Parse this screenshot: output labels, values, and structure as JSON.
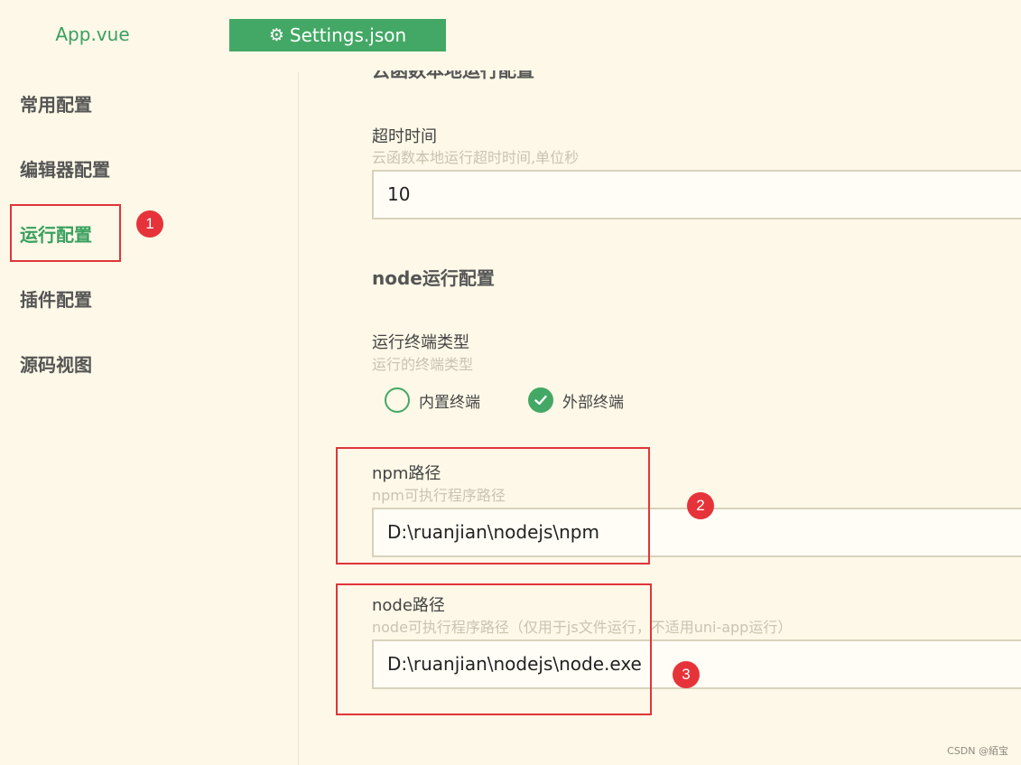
{
  "tabs": [
    {
      "label": "App.vue",
      "active": false
    },
    {
      "label": "Settings.json",
      "active": true,
      "icon": "gear-icon"
    }
  ],
  "sidebar": {
    "items": [
      {
        "label": "常用配置",
        "active": false
      },
      {
        "label": "编辑器配置",
        "active": false
      },
      {
        "label": "运行配置",
        "active": true
      },
      {
        "label": "插件配置",
        "active": false
      },
      {
        "label": "源码视图",
        "active": false
      }
    ]
  },
  "main": {
    "section_cloud_title": "云函数本地运行配置",
    "timeout": {
      "label": "超时时间",
      "description": "云函数本地运行超时时间,单位秒",
      "value": "10"
    },
    "section_node_title": "node运行配置",
    "terminal_type": {
      "label": "运行终端类型",
      "description": "运行的终端类型",
      "options": [
        {
          "label": "内置终端",
          "checked": false
        },
        {
          "label": "外部终端",
          "checked": true
        }
      ]
    },
    "npm_path": {
      "label": "npm路径",
      "description": "npm可执行程序路径",
      "value": "D:\\ruanjian\\nodejs\\npm"
    },
    "node_path": {
      "label": "node路径",
      "description": "node可执行程序路径（仅用于js文件运行，不适用uni-app运行）",
      "value": "D:\\ruanjian\\nodejs\\node.exe"
    }
  },
  "annotations": {
    "markers": [
      "1",
      "2",
      "3"
    ],
    "color": "#e6333a"
  },
  "watermark": "CSDN @絔宝",
  "colors": {
    "background": "#fdf8e7",
    "accent": "#43a865",
    "annotation": "#e0353a"
  }
}
